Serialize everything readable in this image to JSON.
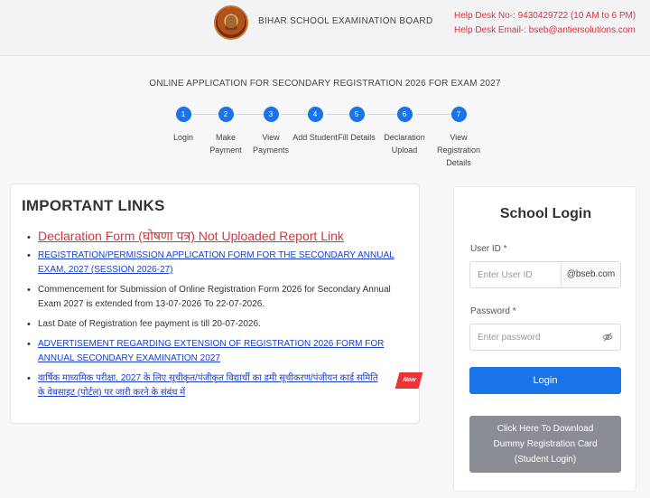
{
  "header": {
    "board_name": "BIHAR SCHOOL EXAMINATION BOARD",
    "help_desk_no": "Help Desk No-: 9430429722 (10 AM to 6 PM)",
    "help_desk_email": "Help Desk Email-: bseb@antiersolutions.com",
    "logo_icon": "bseb-emblem-icon"
  },
  "app_title": "ONLINE APPLICATION FOR SECONDARY REGISTRATION 2026 FOR EXAM 2027",
  "steps": [
    {
      "num": "1",
      "label": "Login"
    },
    {
      "num": "2",
      "label": "Make Payment"
    },
    {
      "num": "3",
      "label": "View Payments"
    },
    {
      "num": "4",
      "label": "Add Student"
    },
    {
      "num": "5",
      "label": "Fill Details"
    },
    {
      "num": "6",
      "label": "Declaration Upload"
    },
    {
      "num": "7",
      "label": "View Registration Details"
    }
  ],
  "links": {
    "title": "IMPORTANT LINKS",
    "items": [
      "Declaration Form (घोषणा पत्र) Not Uploaded Report Link",
      "REGISTRATION/PERMISSION APPLICATION FORM FOR THE SECONDARY ANNUAL EXAM, 2027 (SESSION 2026-27)",
      "Commencement for Submission of Online Registration Form 2026 for Secondary Annual Exam 2027 is extended from 13-07-2026 To 22-07-2026.",
      "Last Date of Registration fee payment is till 20-07-2026.",
      "ADVERTISEMENT REGARDING EXTENSION OF REGISTRATION 2026 FORM FOR ANNUAL SECONDARY EXAMINATION 2027",
      "वार्षिक माध्यमिक परीक्षा, 2027 के लिए सूचीकृत/पंजीकृत विद्यार्थी का डमी सूचीकरण/पंजीयन कार्ड समिति के वेबसाइट (पोर्टल) पर जारी करने के संबंध में"
    ],
    "new_badge": "New"
  },
  "login": {
    "title": "School Login",
    "user_id_label": "User ID",
    "user_id_placeholder": "Enter User ID",
    "user_id_suffix": "@bseb.com",
    "password_label": "Password",
    "password_placeholder": "Enter password",
    "required_mark": "*",
    "login_button": "Login",
    "dummy_button": "Click Here To Download Dummy Registration Card (Student Login)"
  },
  "colors": {
    "accent": "#1a73e8",
    "help_text": "#e0303a",
    "link": "#1a3fcf",
    "new_badge": "#ee3333",
    "dummy_button": "#8a8e94"
  }
}
